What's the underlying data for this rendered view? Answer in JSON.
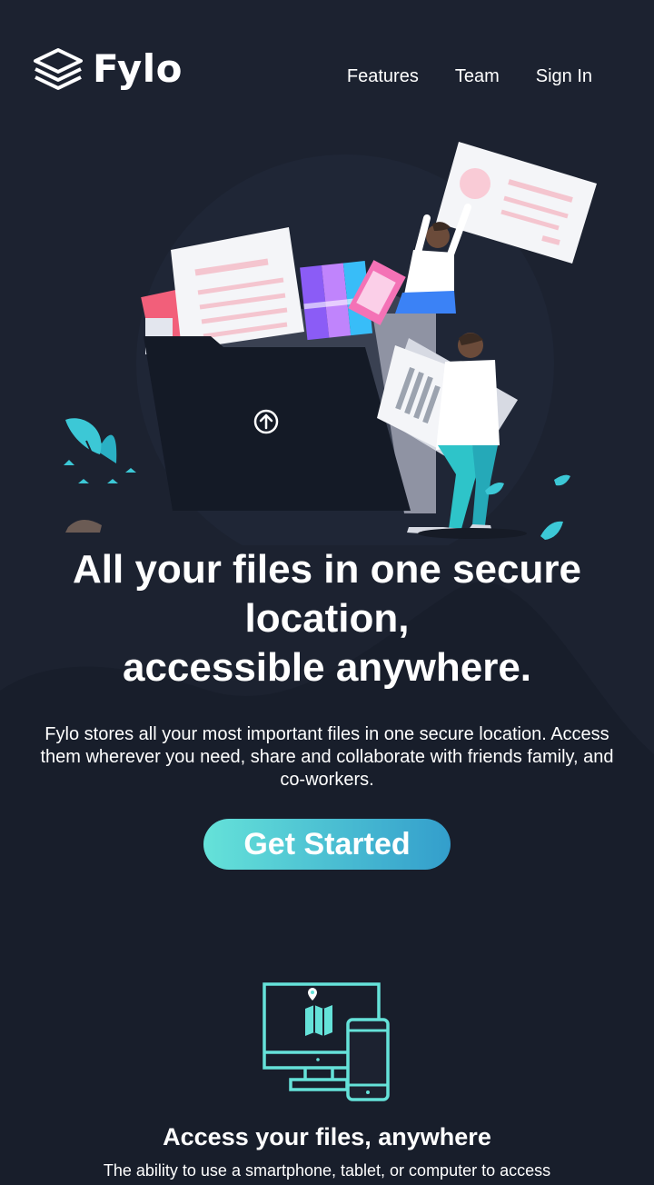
{
  "brand": {
    "name": "Fylo",
    "logo_icon": "layered-stack-icon"
  },
  "nav": {
    "items": [
      {
        "label": "Features"
      },
      {
        "label": "Team"
      },
      {
        "label": "Sign In"
      }
    ]
  },
  "hero": {
    "illustration_icon": "file-folder-illustration",
    "upload_icon": "arrow-up-circle-icon",
    "title_line1": "All your files in one secure location,",
    "title_line2": "accessible anywhere.",
    "subtitle": "Fylo stores all your most important files in one secure location. Access them wherever you need, share and collaborate with friends family, and co-workers.",
    "cta_label": "Get Started"
  },
  "features": [
    {
      "icon": "monitor-phone-icon",
      "title": "Access your files, anywhere",
      "description": "The ability to use a smartphone, tablet, or computer to access your account means your files follow you everywhere."
    }
  ],
  "colors": {
    "background": "#1c2230",
    "background_curve": "#181e2b",
    "accent_teal": "#65e2d9",
    "accent_blue": "#339ecc",
    "text": "#ffffff"
  }
}
